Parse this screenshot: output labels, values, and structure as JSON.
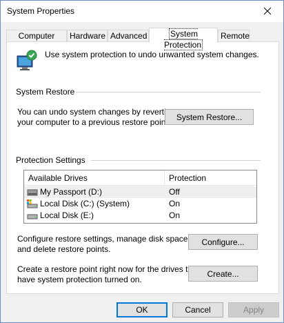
{
  "window": {
    "title": "System Properties"
  },
  "tabs": [
    {
      "label": "Computer Name"
    },
    {
      "label": "Hardware"
    },
    {
      "label": "Advanced"
    },
    {
      "label": "System Protection"
    },
    {
      "label": "Remote"
    }
  ],
  "intro_text": "Use system protection to undo unwanted system changes.",
  "system_restore": {
    "group_title": "System Restore",
    "description_line1": "You can undo system changes by reverting",
    "description_line2": "your computer to a previous restore point.",
    "button_label": "System Restore..."
  },
  "protection_settings": {
    "group_title": "Protection Settings",
    "columns": [
      "Available Drives",
      "Protection"
    ],
    "drives": [
      {
        "name": "My Passport (D:)",
        "protection": "Off",
        "icon": "external-drive-icon"
      },
      {
        "name": "Local Disk (C:) (System)",
        "protection": "On",
        "icon": "system-drive-icon"
      },
      {
        "name": "Local Disk (E:)",
        "protection": "On",
        "icon": "hard-drive-icon"
      }
    ],
    "configure_text_line1": "Configure restore settings, manage disk space,",
    "configure_text_line2": "and delete restore points.",
    "configure_button": "Configure...",
    "create_text_line1": "Create a restore point right now for the drives that",
    "create_text_line2": "have system protection turned on.",
    "create_button": "Create..."
  },
  "footer": {
    "ok": "OK",
    "cancel": "Cancel",
    "apply": "Apply"
  }
}
